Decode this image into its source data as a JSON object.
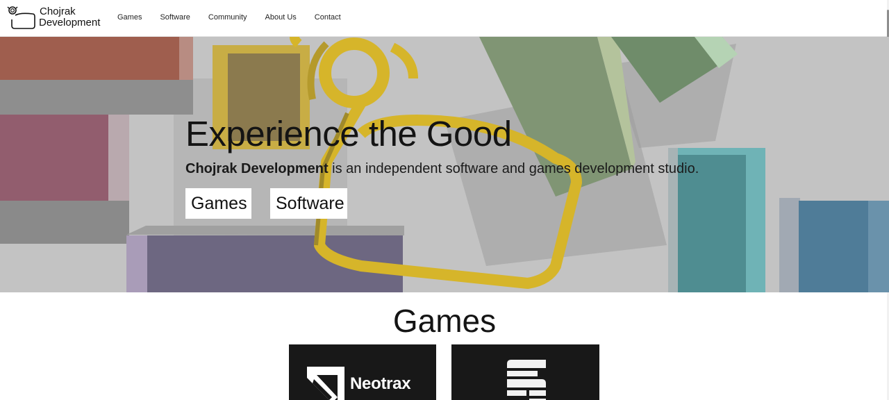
{
  "header": {
    "logo": {
      "line1": "Chojrak",
      "line2": "Development",
      "icon": "chojrak-mascot-icon"
    },
    "nav": [
      {
        "label": "Games"
      },
      {
        "label": "Software"
      },
      {
        "label": "Community"
      },
      {
        "label": "About Us"
      },
      {
        "label": "Contact"
      }
    ]
  },
  "hero": {
    "title": "Experience the Good",
    "subtitle_brand": "Chojrak Development",
    "subtitle_rest": " is an independent software and games development studio.",
    "buttons": {
      "games": "Games",
      "software": "Software"
    },
    "background": "3d-blocks-and-mascot-render"
  },
  "games_section": {
    "title": "Games",
    "cards": [
      {
        "name": "Neotrax",
        "icon": "neotrax-logo-icon"
      },
      {
        "name": "",
        "icon": "stacked-s-logo-icon"
      }
    ]
  },
  "colors": {
    "mascot_yellow": "#d7b62a",
    "hero_background": "#c4c4c4",
    "card_background": "#181818"
  }
}
